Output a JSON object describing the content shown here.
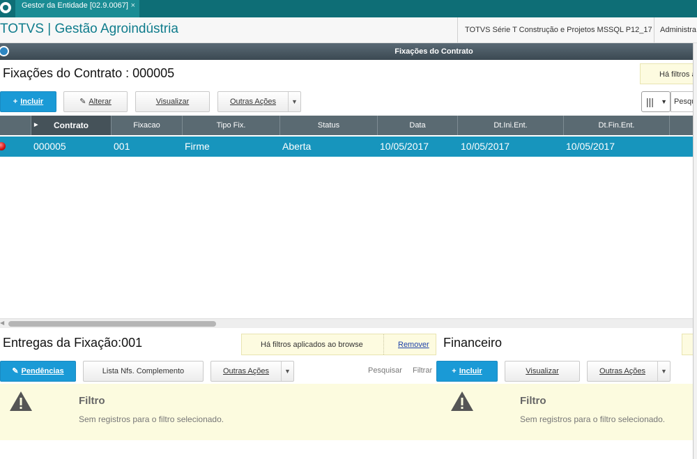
{
  "tab": {
    "title": "Gestor da Entidade [02.9.0067]",
    "close": "×"
  },
  "header": {
    "brand": "TOTVS | Gestão Agroindústria",
    "environment": "TOTVS Série T Construção e Projetos MSSQL P12_17",
    "user": "Administra"
  },
  "window": {
    "title": "Fixações do Contrato"
  },
  "fixacoes": {
    "title": "Fixações do Contrato : 000005",
    "filter_note": "Há filtros a",
    "buttons": {
      "incluir": "Incluir",
      "alterar": "Alterar",
      "visualizar": "Visualizar",
      "outras": "Outras Ações"
    },
    "search_placeholder": "Pesqu",
    "columns": [
      "Contrato",
      "Fixacao",
      "Tipo Fix.",
      "Status",
      "Data",
      "Dt.Ini.Ent.",
      "Dt.Fin.Ent."
    ],
    "rows": [
      {
        "contrato": "000005",
        "fixacao": "001",
        "tipo": "Firme",
        "status": "Aberta",
        "data": "10/05/2017",
        "ini": "10/05/2017",
        "fin": "10/05/2017"
      }
    ]
  },
  "entregas": {
    "title": "Entregas da Fixação:001",
    "filter_note": "Há filtros aplicados ao browse",
    "remove": "Remover",
    "buttons": {
      "pendencias": "Pendências",
      "lista": "Lista Nfs. Complemento",
      "outras": "Outras Ações"
    },
    "pesquisar": "Pesquisar",
    "filtrar": "Filtrar",
    "empty_title": "Filtro",
    "empty_msg": "Sem registros para o filtro selecionado."
  },
  "financeiro": {
    "title": "Financeiro",
    "buttons": {
      "incluir": "Incluir",
      "visualizar": "Visualizar",
      "outras": "Outras Ações"
    },
    "empty_title": "Filtro",
    "empty_msg": "Sem registros para o filtro selecionado."
  },
  "colors": {
    "teal": "#0e6e76",
    "accent": "#1a9ad6",
    "row_selected": "#1795bd",
    "grid_header": "#5a6a72"
  }
}
